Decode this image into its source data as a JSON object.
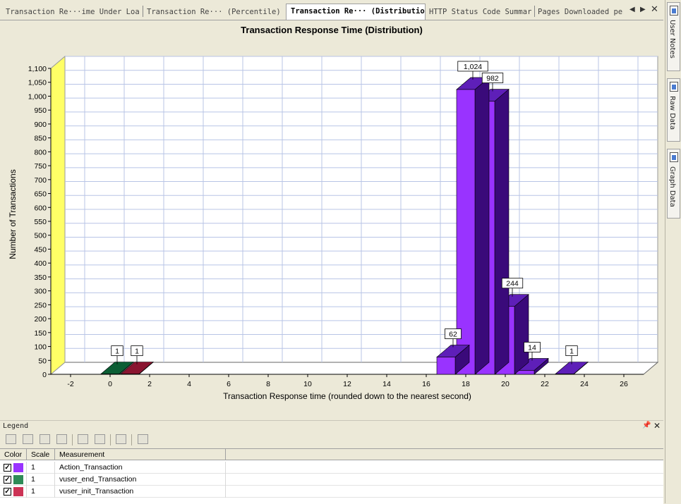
{
  "tabs": [
    {
      "label": "Transaction Re···ime Under Load",
      "active": false
    },
    {
      "label": "Transaction Re··· (Percentile)",
      "active": false
    },
    {
      "label": "Transaction Re··· (Distribution)",
      "active": true
    },
    {
      "label": "HTTP Status Code Summary",
      "active": false
    },
    {
      "label": "Pages Downloaded per",
      "active": false
    }
  ],
  "side_panels": [
    "User Notes",
    "Raw Data",
    "Graph Data"
  ],
  "chart_data": {
    "type": "bar",
    "title": "Transaction Response Time (Distribution)",
    "xlabel": "Transaction Response time (rounded down to the nearest second)",
    "ylabel": "Number of Transactions",
    "xlim": [
      -3,
      27
    ],
    "ylim": [
      0,
      1100
    ],
    "x_ticks": [
      -2,
      0,
      2,
      4,
      6,
      8,
      10,
      12,
      14,
      16,
      18,
      20,
      22,
      24,
      26
    ],
    "y_ticks": [
      0,
      50,
      100,
      150,
      200,
      250,
      300,
      350,
      400,
      450,
      500,
      550,
      600,
      650,
      700,
      750,
      800,
      850,
      900,
      950,
      1000,
      1050,
      1100
    ],
    "y_tick_labels": [
      "0",
      "50",
      "100",
      "150",
      "200",
      "250",
      "300",
      "350",
      "400",
      "450",
      "500",
      "550",
      "600",
      "650",
      "700",
      "750",
      "800",
      "850",
      "900",
      "950",
      "1,000",
      "1,050",
      "1,100"
    ],
    "grid": true,
    "series": [
      {
        "name": "Action_Transaction",
        "color": "#9933ff",
        "side_color": "#3a0a7a",
        "top_color": "#5e1fb8",
        "points": [
          {
            "x": 17,
            "value": 62,
            "label": "62"
          },
          {
            "x": 18,
            "value": 1024,
            "label": "1,024"
          },
          {
            "x": 19,
            "value": 982,
            "label": "982"
          },
          {
            "x": 20,
            "value": 244,
            "label": "244"
          },
          {
            "x": 21,
            "value": 14,
            "label": "14"
          },
          {
            "x": 23,
            "value": 1,
            "label": "1"
          }
        ]
      },
      {
        "name": "vuser_end_Transaction",
        "color": "#2e8b57",
        "side_color": "#0f3d22",
        "top_color": "#0b5e34",
        "points": [
          {
            "x": 0,
            "value": 1,
            "label": "1"
          }
        ]
      },
      {
        "name": "vuser_init_Transaction",
        "color": "#cc3355",
        "side_color": "#4a0d1a",
        "top_color": "#8a1530",
        "points": [
          {
            "x": 1,
            "value": 1,
            "label": "1"
          }
        ]
      }
    ]
  },
  "legend": {
    "title": "Legend",
    "columns": [
      "Color",
      "Scale",
      "Measurement"
    ],
    "rows": [
      {
        "checked": true,
        "color": "#9933ff",
        "scale": "1",
        "measurement": "Action_Transaction"
      },
      {
        "checked": true,
        "color": "#2e8b57",
        "scale": "1",
        "measurement": "vuser_end_Transaction"
      },
      {
        "checked": true,
        "color": "#cc3355",
        "scale": "1",
        "measurement": "vuser_init_Transaction"
      }
    ]
  }
}
